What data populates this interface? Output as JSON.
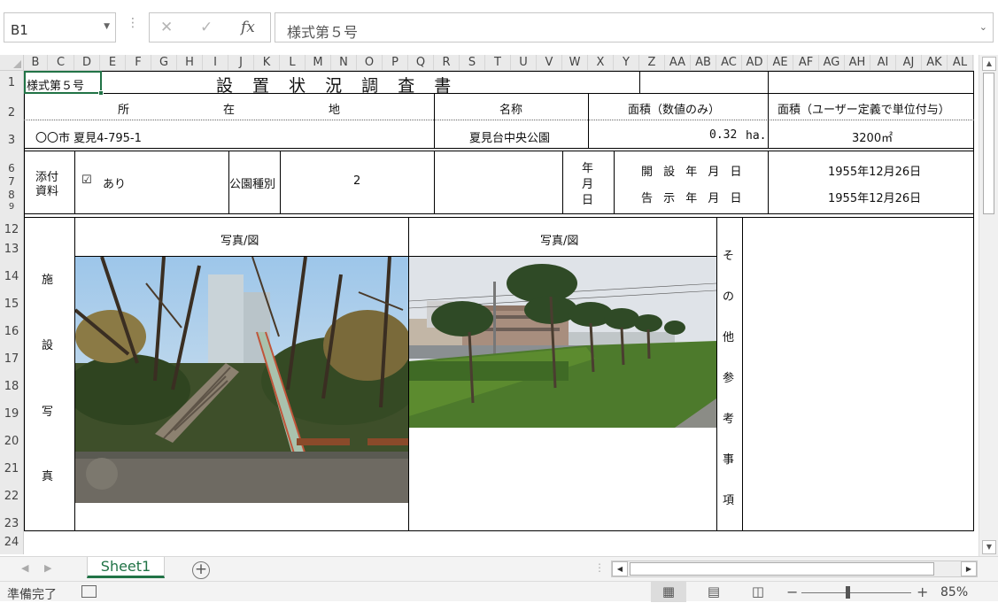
{
  "formula_bar": {
    "name_box": "B1",
    "cancel_icon": "✕",
    "enter_icon": "✓",
    "fx_icon": "fx",
    "content": "様式第５号"
  },
  "columns": [
    "B",
    "C",
    "D",
    "E",
    "F",
    "G",
    "H",
    "I",
    "J",
    "K",
    "L",
    "M",
    "N",
    "O",
    "P",
    "Q",
    "R",
    "S",
    "T",
    "U",
    "V",
    "W",
    "X",
    "Y",
    "Z",
    "AA",
    "AB",
    "AC",
    "AD",
    "AE",
    "AF",
    "AG",
    "AH",
    "AI",
    "AJ",
    "AK",
    "AL"
  ],
  "rows": {
    "r1": "1",
    "r2": "2",
    "r3": "3",
    "r6": "6",
    "r7": "7",
    "r8": "8",
    "r9": "9",
    "r12": "12",
    "r13": "13",
    "r14": "14",
    "r15": "15",
    "r16": "16",
    "r17": "17",
    "r18": "18",
    "r19": "19",
    "r20": "20",
    "r21": "21",
    "r22": "22",
    "r23": "23",
    "r24": "24"
  },
  "sheet": {
    "form_no": "様式第５号",
    "title": "設 置 状 況 調 査 書",
    "hdr_location": [
      "所",
      "在",
      "地"
    ],
    "hdr_name": "名称",
    "hdr_area_num": "面積（数値のみ）",
    "hdr_area_unit": "面積（ユーザー定義で単位付与）",
    "location": "〇〇市 夏見4-795-1",
    "name": "夏見台中央公園",
    "area_num": "0.32",
    "area_unit_ha": "ha.",
    "area_user": "3200㎡",
    "attach_label_1": "添付",
    "attach_label_2": "資料",
    "checkbox_icon": "☑",
    "attach_value": "あり",
    "park_type_label": "公園種別",
    "park_type_value": "2",
    "ymd": [
      "年",
      "月",
      "日"
    ],
    "open_date_label": "開 設 年 月 日",
    "open_date": "1955年12月26日",
    "notice_date_label": "告 示 年 月 日",
    "notice_date": "1955年12月26日",
    "facility_photo_label": [
      "施",
      "設",
      "写",
      "真"
    ],
    "photo_header_1": "写真/図",
    "photo_header_2": "写真/図",
    "other_notes_label": [
      "そ",
      "の",
      "他",
      "参",
      "考",
      "事",
      "項"
    ]
  },
  "tabs": {
    "sheet1": "Sheet1",
    "add_icon": "+"
  },
  "status": {
    "ready": "準備完了",
    "zoom_minus": "−",
    "zoom_plus": "+",
    "zoom": "85%",
    "zoom_level_percent": 85
  },
  "colors": {
    "excel_green": "#217346",
    "grid_header": "#eaeaea",
    "selection": "#217346"
  }
}
